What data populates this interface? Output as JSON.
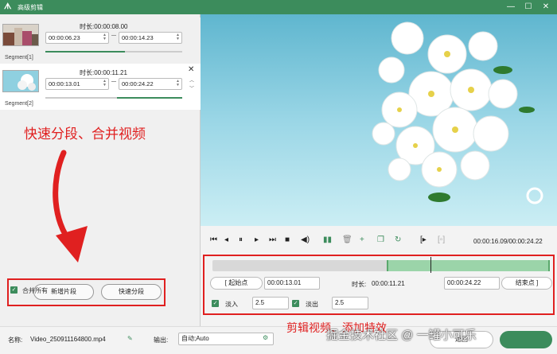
{
  "window": {
    "title": "高级剪辑",
    "minimize": "—",
    "maximize": "☐",
    "close": "✕"
  },
  "segments": [
    {
      "duration_label": "时长:",
      "duration": "00:00:08.00",
      "start": "00:00:06.23",
      "end": "00:00:14.23",
      "label": "Segment[1]"
    },
    {
      "duration_label": "时长:",
      "duration": "00:00:11.21",
      "start": "00:00:13.01",
      "end": "00:00:24.22",
      "label": "Segment[2]"
    }
  ],
  "annotation_left": "快速分段、合并视频",
  "buttons": {
    "new_segment": "新增片段",
    "quick_split": "快速分段"
  },
  "merge_all": "合并所有",
  "player": {
    "timecode": "00:00:16.09/00:00:24.22"
  },
  "edit": {
    "start_btn": "起始点",
    "start_time": "00:00:13.01",
    "duration_label": "时长:",
    "duration": "00:00:11.21",
    "end_time": "00:00:24.22",
    "end_btn": "结束点",
    "fade_in_label": "淡入",
    "fade_in_value": "2.5",
    "fade_out_label": "淡出",
    "fade_out_value": "2.5"
  },
  "annotation_bottom": "剪辑视频、添加特效",
  "watermark": "掘金技术社区 @ 一罐小可乐",
  "bottom": {
    "name_label": "名称:",
    "file_name": "Video_250911164800.mp4",
    "output_label": "输出:",
    "output_value": "自动;Auto",
    "back_label": "返回",
    "ok_label": ""
  }
}
